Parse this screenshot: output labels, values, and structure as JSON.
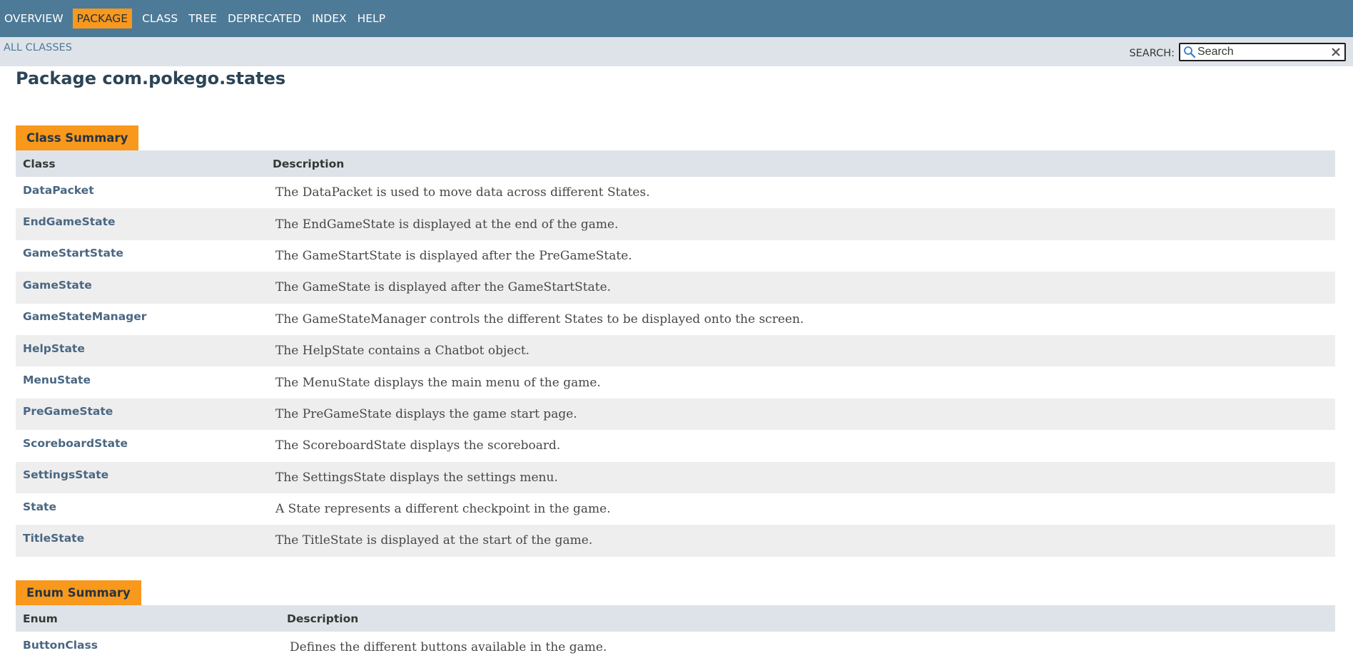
{
  "topnav": {
    "items": [
      "Overview",
      "Package",
      "Class",
      "Tree",
      "Deprecated",
      "Index",
      "Help"
    ],
    "active": "Package"
  },
  "subnav": {
    "all_classes": "ALL CLASSES",
    "search_label": "SEARCH:",
    "search_value": "Search"
  },
  "page_title": "Package com.pokego.states",
  "class_summary": {
    "caption": "Class Summary",
    "headers": [
      "Class",
      "Description"
    ],
    "rows": [
      {
        "name": "DataPacket",
        "desc": "The DataPacket is used to move data across different States."
      },
      {
        "name": "EndGameState",
        "desc": "The EndGameState is displayed at the end of the game."
      },
      {
        "name": "GameStartState",
        "desc": "The GameStartState is displayed after the PreGameState."
      },
      {
        "name": "GameState",
        "desc": "The GameState is displayed after the GameStartState."
      },
      {
        "name": "GameStateManager",
        "desc": "The GameStateManager controls the different States to be displayed onto the screen."
      },
      {
        "name": "HelpState",
        "desc": "The HelpState contains a Chatbot object."
      },
      {
        "name": "MenuState",
        "desc": "The MenuState displays the main menu of the game."
      },
      {
        "name": "PreGameState",
        "desc": "The PreGameState displays the game start page."
      },
      {
        "name": "ScoreboardState",
        "desc": "The ScoreboardState displays the scoreboard."
      },
      {
        "name": "SettingsState",
        "desc": "The SettingsState displays the settings menu."
      },
      {
        "name": "State",
        "desc": "A State represents a different checkpoint in the game."
      },
      {
        "name": "TitleState",
        "desc": "The TitleState is displayed at the start of the game."
      }
    ]
  },
  "enum_summary": {
    "caption": "Enum Summary",
    "headers": [
      "Enum",
      "Description"
    ],
    "rows": [
      {
        "name": "ButtonClass",
        "desc": "Defines the different buttons available in the game."
      }
    ]
  },
  "colors": {
    "nav_bg": "#4D7A97",
    "accent": "#F8981D",
    "subnav_bg": "#dee3e9",
    "link": "#4A6782"
  },
  "icons": {
    "search": "magnifier-icon",
    "clear": "close-icon"
  }
}
